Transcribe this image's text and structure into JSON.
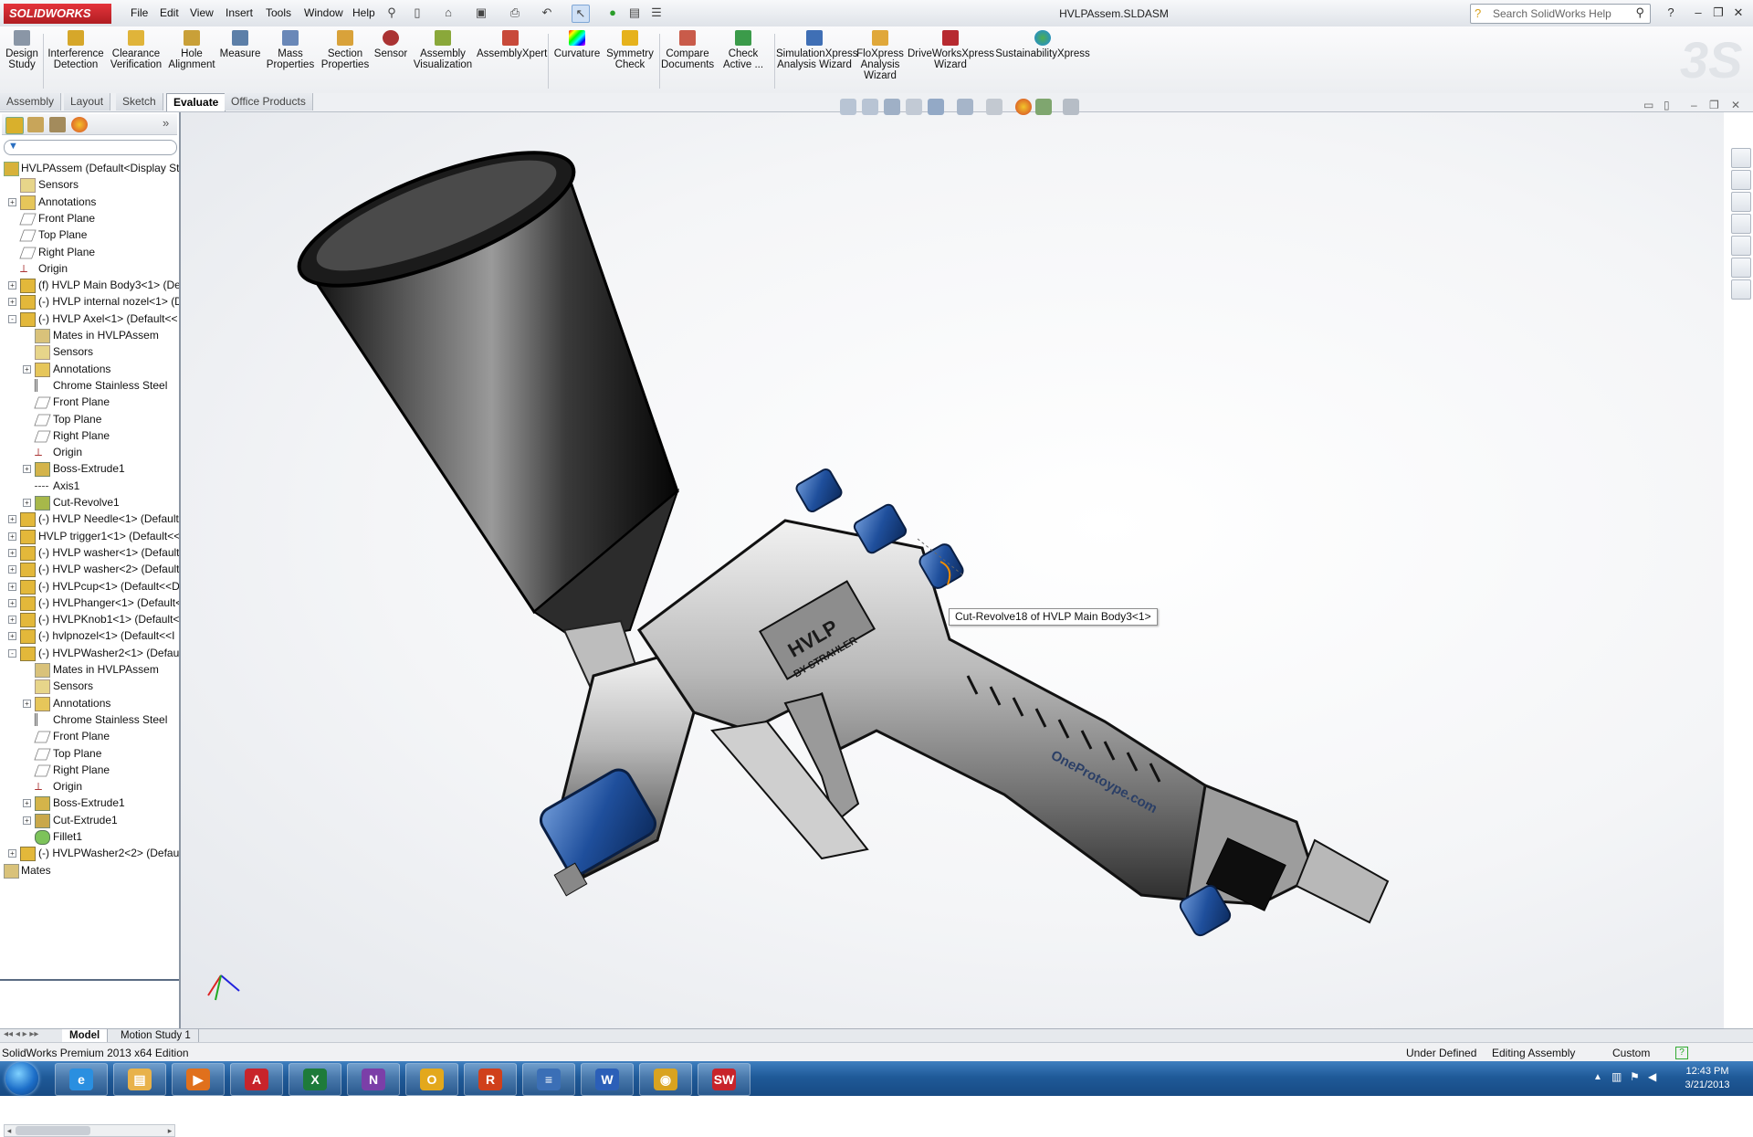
{
  "app": {
    "brand": "SOLIDWORKS",
    "doc_title": "HVLPAssem.SLDASM",
    "menu": [
      "File",
      "Edit",
      "View",
      "Insert",
      "Tools",
      "Window",
      "Help"
    ],
    "search_placeholder": "Search SolidWorks Help",
    "accent": "#c8242b"
  },
  "command_manager": {
    "buttons": [
      {
        "label": "Design\nStudy",
        "icon": "design-study-icon"
      },
      {
        "label": "Interference\nDetection",
        "icon": "interference-icon"
      },
      {
        "label": "Clearance\nVerification",
        "icon": "clearance-icon"
      },
      {
        "label": "Hole\nAlignment",
        "icon": "hole-alignment-icon"
      },
      {
        "label": "Measure",
        "icon": "measure-icon"
      },
      {
        "label": "Mass\nProperties",
        "icon": "mass-properties-icon"
      },
      {
        "label": "Section\nProperties",
        "icon": "section-properties-icon"
      },
      {
        "label": "Sensor",
        "icon": "sensor-icon"
      },
      {
        "label": "Assembly\nVisualization",
        "icon": "assembly-visualization-icon"
      },
      {
        "label": "AssemblyXpert",
        "icon": "assemblyxpert-icon"
      },
      {
        "label": "Curvature",
        "icon": "curvature-icon"
      },
      {
        "label": "Symmetry\nCheck",
        "icon": "symmetry-icon"
      },
      {
        "label": "Compare\nDocuments",
        "icon": "compare-icon"
      },
      {
        "label": "Check\nActive ...",
        "icon": "check-active-icon"
      },
      {
        "label": "SimulationXpress\nAnalysis Wizard",
        "icon": "simulation-icon"
      },
      {
        "label": "FloXpress\nAnalysis\nWizard",
        "icon": "floxpress-icon"
      },
      {
        "label": "DriveWorksXpress\nWizard",
        "icon": "driveworks-icon"
      },
      {
        "label": "SustainabilityXpress",
        "icon": "sustainability-icon"
      }
    ],
    "tabs": [
      "Assembly",
      "Layout",
      "Sketch",
      "Evaluate",
      "Office Products"
    ],
    "active_tab": "Evaluate"
  },
  "feature_tree": [
    {
      "level": 0,
      "expand": "",
      "icon": "assembly",
      "label": "HVLPAssem  (Default<Display St"
    },
    {
      "level": 1,
      "expand": "",
      "icon": "sensor",
      "label": "Sensors"
    },
    {
      "level": 1,
      "expand": "+",
      "icon": "annotation",
      "label": "Annotations"
    },
    {
      "level": 1,
      "expand": "",
      "icon": "plane",
      "label": "Front Plane"
    },
    {
      "level": 1,
      "expand": "",
      "icon": "plane",
      "label": "Top Plane"
    },
    {
      "level": 1,
      "expand": "",
      "icon": "plane",
      "label": "Right Plane"
    },
    {
      "level": 1,
      "expand": "",
      "icon": "origin",
      "label": "Origin"
    },
    {
      "level": 1,
      "expand": "+",
      "icon": "part",
      "label": "(f) HVLP Main Body3<1> (De"
    },
    {
      "level": 1,
      "expand": "+",
      "icon": "part",
      "label": "(-) HVLP internal nozel<1> (D"
    },
    {
      "level": 1,
      "expand": "-",
      "icon": "part",
      "label": "(-) HVLP Axel<1> (Default<<"
    },
    {
      "level": 2,
      "expand": "",
      "icon": "mates",
      "label": "Mates in HVLPAssem"
    },
    {
      "level": 2,
      "expand": "",
      "icon": "sensor",
      "label": "Sensors"
    },
    {
      "level": 2,
      "expand": "+",
      "icon": "annotation",
      "label": "Annotations"
    },
    {
      "level": 2,
      "expand": "",
      "icon": "material",
      "label": "Chrome Stainless Steel"
    },
    {
      "level": 2,
      "expand": "",
      "icon": "plane",
      "label": "Front Plane"
    },
    {
      "level": 2,
      "expand": "",
      "icon": "plane",
      "label": "Top Plane"
    },
    {
      "level": 2,
      "expand": "",
      "icon": "plane",
      "label": "Right Plane"
    },
    {
      "level": 2,
      "expand": "",
      "icon": "origin",
      "label": "Origin"
    },
    {
      "level": 2,
      "expand": "+",
      "icon": "feature",
      "label": "Boss-Extrude1"
    },
    {
      "level": 2,
      "expand": "",
      "icon": "axis",
      "label": "Axis1"
    },
    {
      "level": 2,
      "expand": "+",
      "icon": "revolve",
      "label": "Cut-Revolve1"
    },
    {
      "level": 1,
      "expand": "+",
      "icon": "part",
      "label": "(-) HVLP Needle<1> (Default"
    },
    {
      "level": 1,
      "expand": "+",
      "icon": "part",
      "label": "HVLP trigger1<1> (Default<<"
    },
    {
      "level": 1,
      "expand": "+",
      "icon": "part",
      "label": "(-) HVLP washer<1> (Default"
    },
    {
      "level": 1,
      "expand": "+",
      "icon": "part",
      "label": "(-) HVLP washer<2> (Default"
    },
    {
      "level": 1,
      "expand": "+",
      "icon": "part",
      "label": "(-) HVLPcup<1> (Default<<D"
    },
    {
      "level": 1,
      "expand": "+",
      "icon": "part",
      "label": "(-) HVLPhanger<1> (Default<"
    },
    {
      "level": 1,
      "expand": "+",
      "icon": "part",
      "label": "(-) HVLPKnob1<1> (Default<"
    },
    {
      "level": 1,
      "expand": "+",
      "icon": "part",
      "label": "(-) hvlpnozel<1> (Default<<I"
    },
    {
      "level": 1,
      "expand": "-",
      "icon": "part",
      "label": "(-) HVLPWasher2<1> (Defaul"
    },
    {
      "level": 2,
      "expand": "",
      "icon": "mates",
      "label": "Mates in HVLPAssem"
    },
    {
      "level": 2,
      "expand": "",
      "icon": "sensor",
      "label": "Sensors"
    },
    {
      "level": 2,
      "expand": "+",
      "icon": "annotation",
      "label": "Annotations"
    },
    {
      "level": 2,
      "expand": "",
      "icon": "material",
      "label": "Chrome Stainless Steel"
    },
    {
      "level": 2,
      "expand": "",
      "icon": "plane",
      "label": "Front Plane"
    },
    {
      "level": 2,
      "expand": "",
      "icon": "plane",
      "label": "Top Plane"
    },
    {
      "level": 2,
      "expand": "",
      "icon": "plane",
      "label": "Right Plane"
    },
    {
      "level": 2,
      "expand": "",
      "icon": "origin",
      "label": "Origin"
    },
    {
      "level": 2,
      "expand": "+",
      "icon": "feature",
      "label": "Boss-Extrude1"
    },
    {
      "level": 2,
      "expand": "+",
      "icon": "cut",
      "label": "Cut-Extrude1"
    },
    {
      "level": 2,
      "expand": "",
      "icon": "fillet",
      "label": "Fillet1"
    },
    {
      "level": 1,
      "expand": "+",
      "icon": "part",
      "label": "(-) HVLPWasher2<2> (Defaul"
    },
    {
      "level": 0,
      "expand": "+",
      "icon": "mates",
      "label": "Mates"
    }
  ],
  "viewport": {
    "tooltip": "Cut-Revolve18 of HVLP Main Body3<1>",
    "model_text_1": "HVLP",
    "model_text_2": "BY STRAHLER",
    "model_text_3": "OneProtoype.com"
  },
  "bottom_tabs": [
    "Model",
    "Motion Study 1"
  ],
  "active_bottom_tab": "Model",
  "status": {
    "edition": "SolidWorks Premium 2013 x64 Edition",
    "state": "Under Defined",
    "mode": "Editing Assembly",
    "units": "Custom",
    "help": "?"
  },
  "taskbar": {
    "time": "12:43 PM",
    "date": "3/21/2013",
    "apps": [
      {
        "name": "internet-explorer-icon",
        "glyph": "e",
        "color": "#2a8fe0"
      },
      {
        "name": "file-explorer-icon",
        "glyph": "▤",
        "color": "#e8b24a"
      },
      {
        "name": "media-player-icon",
        "glyph": "▶",
        "color": "#e0701c"
      },
      {
        "name": "acrobat-icon",
        "glyph": "A",
        "color": "#c8242b"
      },
      {
        "name": "excel-icon",
        "glyph": "X",
        "color": "#1e7b3a"
      },
      {
        "name": "onenote-icon",
        "glyph": "N",
        "color": "#7b3fa8"
      },
      {
        "name": "outlook-icon",
        "glyph": "O",
        "color": "#e3a81c"
      },
      {
        "name": "adobe-reader-icon",
        "glyph": "R",
        "color": "#d0401b"
      },
      {
        "name": "documents-icon",
        "glyph": "≡",
        "color": "#3b6fb6"
      },
      {
        "name": "word-icon",
        "glyph": "W",
        "color": "#2b5fb8"
      },
      {
        "name": "chrome-icon",
        "glyph": "◉",
        "color": "#d9a320"
      },
      {
        "name": "solidworks-icon",
        "glyph": "SW",
        "color": "#c8242b"
      }
    ]
  }
}
